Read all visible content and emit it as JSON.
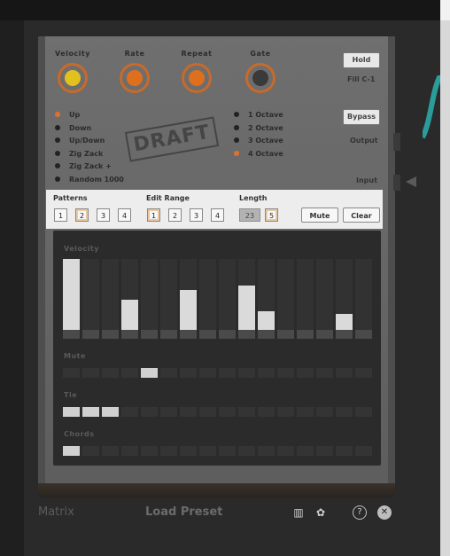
{
  "colors": {
    "background": "#1f1f1f",
    "accent_orange": "#e07030",
    "knob_yellow": "#e2c11e",
    "knob_orange": "#de6f1d",
    "knob_dark": "#3a3a3a",
    "panel": "#ededed",
    "step_on": "#dadada",
    "cable_teal": "#2a9c9a"
  },
  "knobs": [
    {
      "label": "Velocity",
      "color": "#e2c11e"
    },
    {
      "label": "Rate",
      "color": "#de6f1d"
    },
    {
      "label": "Repeat",
      "color": "#de6f1d"
    },
    {
      "label": "Gate",
      "color": "#3a3a3a"
    }
  ],
  "side": {
    "hold_label": "Hold",
    "fill_text": "Fill C-1",
    "bypass_label": "Bypass",
    "output_label": "Output",
    "input_label": "Input"
  },
  "modes": [
    {
      "label": "Up",
      "active": true
    },
    {
      "label": "Down",
      "active": false
    },
    {
      "label": "Up/Down",
      "active": false
    },
    {
      "label": "Zig Zack",
      "active": false
    },
    {
      "label": "Zig Zack +",
      "active": false
    },
    {
      "label": "Random  1000",
      "active": false
    }
  ],
  "octaves": [
    {
      "label": "1 Octave",
      "active": false
    },
    {
      "label": "2 Octave",
      "active": false
    },
    {
      "label": "3 Octave",
      "active": false
    },
    {
      "label": "4 Octave",
      "active": true
    }
  ],
  "stamp": "DRAFT",
  "controls": {
    "patterns_label": "Patterns",
    "patterns": [
      "1",
      "2",
      "3",
      "4"
    ],
    "patterns_selected": "2",
    "edit_range_label": "Edit Range",
    "edit_range": [
      "1",
      "2",
      "3",
      "4"
    ],
    "edit_range_selected": "1",
    "length_label": "Length",
    "length_value": "23",
    "length_steps": "5",
    "mute_label": "Mute",
    "clear_label": "Clear"
  },
  "grid": {
    "velocity_label": "Velocity",
    "mute_label": "Mute",
    "tie_label": "Tie",
    "chords_label": "Chords",
    "velocity_levels": [
      1.0,
      0,
      0,
      0.42,
      0,
      0,
      0.56,
      0,
      0,
      0.62,
      0.26,
      0,
      0,
      0,
      0.22,
      0
    ],
    "mute": [
      0,
      0,
      0,
      0,
      1,
      0,
      0,
      0,
      0,
      0,
      0,
      0,
      0,
      0,
      0,
      0
    ],
    "tie": [
      1,
      1,
      1,
      0,
      0,
      0,
      0,
      0,
      0,
      0,
      0,
      0,
      0,
      0,
      0,
      0
    ],
    "chords": [
      1,
      0,
      0,
      0,
      0,
      0,
      0,
      0,
      0,
      0,
      0,
      0,
      0,
      0,
      0,
      0
    ]
  },
  "footer": {
    "title": "Matrix",
    "preset": "Load Preset",
    "keyboard_icon": "keyboard-icon",
    "palette_icon": "palette-icon",
    "help_icon": "help-icon",
    "close_icon": "close-icon"
  }
}
